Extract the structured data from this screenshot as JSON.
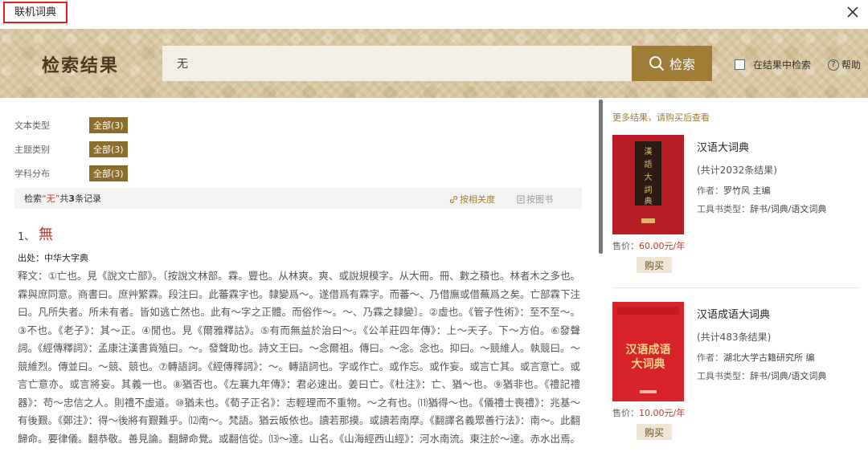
{
  "window": {
    "title": "联机词典"
  },
  "banner": {
    "title": "检索结果",
    "search_value": "无",
    "search_button": "检索",
    "within_results": "在结果中检索",
    "help": "帮助"
  },
  "filters": [
    {
      "label": "文本类型",
      "value": "全部(3)"
    },
    {
      "label": "主题类别",
      "value": "全部(3)"
    },
    {
      "label": "学科分布",
      "value": "全部(3)"
    }
  ],
  "summary": {
    "prefix": "检索 ",
    "term": "“无”",
    "middle": " 共",
    "count": "3",
    "suffix": "条记录",
    "sort_relevance": "按相关度",
    "sort_book": "按图书"
  },
  "result": {
    "index": "1、",
    "headword": "無",
    "source": "出处：中华大字典",
    "text": "释文：①亡也。見《說文亡部》。〔按說文林部。霖。豐也。从林爽。爽、或說規模字。从大冊。冊、數之積也。林者木之多也。霖與庶同意。商書曰。庶艸繁霖。段注曰。此蕃霖字也。隸變爲～。遂借爲有霖字。而蕃～、乃借廡或借蕪爲之矣。亡部霖下注曰。凡所失者。所未有者。皆如逃亡然也。此有～字之正體。而俗作～。～、乃霖之隸變〕。②虛也。《管子性術》：至不至～。③不也。《老子》：其～正。④閒也。見《爾雅釋詁》。⑤有而無益於治曰～。《公羊莊四年傳》：上～天子。下～方伯。⑥發聲詞。《經傳釋詞》：孟康注漢書貨殖曰。～。發聲助也。詩文王曰。～念爾祖。傳曰。～念。念也。抑曰。～競維人。執競曰。～競維烈。傳並曰。～競、競也。⑦轉語詞。《經傳釋詞》：～。轉語詞也。字或作亡。或作忘。或作妄。或言亡其。或言意亡。或言亡意亦。或言將妄。其義一也。⑧猶否也。《左襄九年傳》：君必速出。姜曰亡。《杜注》：亡、猶～也。⑨猶非也。《禮記禮器》：苟～忠信之人。則禮不虛道。⑩猶未也。《荀子正名》：志輕理而不重物。～之有也。⑾猶得～也。《儀禮士喪禮》：兆基～有後艱。《鄭注》：得～後將有艱難乎。⑿南～。梵語。猶云皈依也。讀若那摸。或讀若南摩。《翻譯名義眾善行法》：南～。此翻歸命。要律儀。翻恭敬。善見論。翻歸命覺。或翻信從。⒀～達。山名。《山海經西山經》：河水南流。東注於～達。赤水出焉。"
  },
  "sidebar": {
    "note": "更多结果，请购买后查看",
    "books": [
      {
        "cover_text": "漢語大詞典",
        "title": "汉语大词典",
        "count": "(共计2032条结果)",
        "author_label": "作者：",
        "author": "罗竹风 主编",
        "type_label": "工具书类型：",
        "type": "辞书/词典/语文词典",
        "price_label": "售价：",
        "price": "60.00元/年",
        "buy": "购买",
        "color": "#b81c24"
      },
      {
        "cover_text": "汉语成语大词典",
        "title": "汉语成语大词典",
        "count": "(共计483条结果)",
        "author_label": "作者：",
        "author": "湖北大学古籍研究所 编",
        "type_label": "工具书类型：",
        "type": "辞书/词典/语文词典",
        "price_label": "售价：",
        "price": "10.00元/年",
        "buy": "购买",
        "color": "#d9232b"
      }
    ]
  }
}
